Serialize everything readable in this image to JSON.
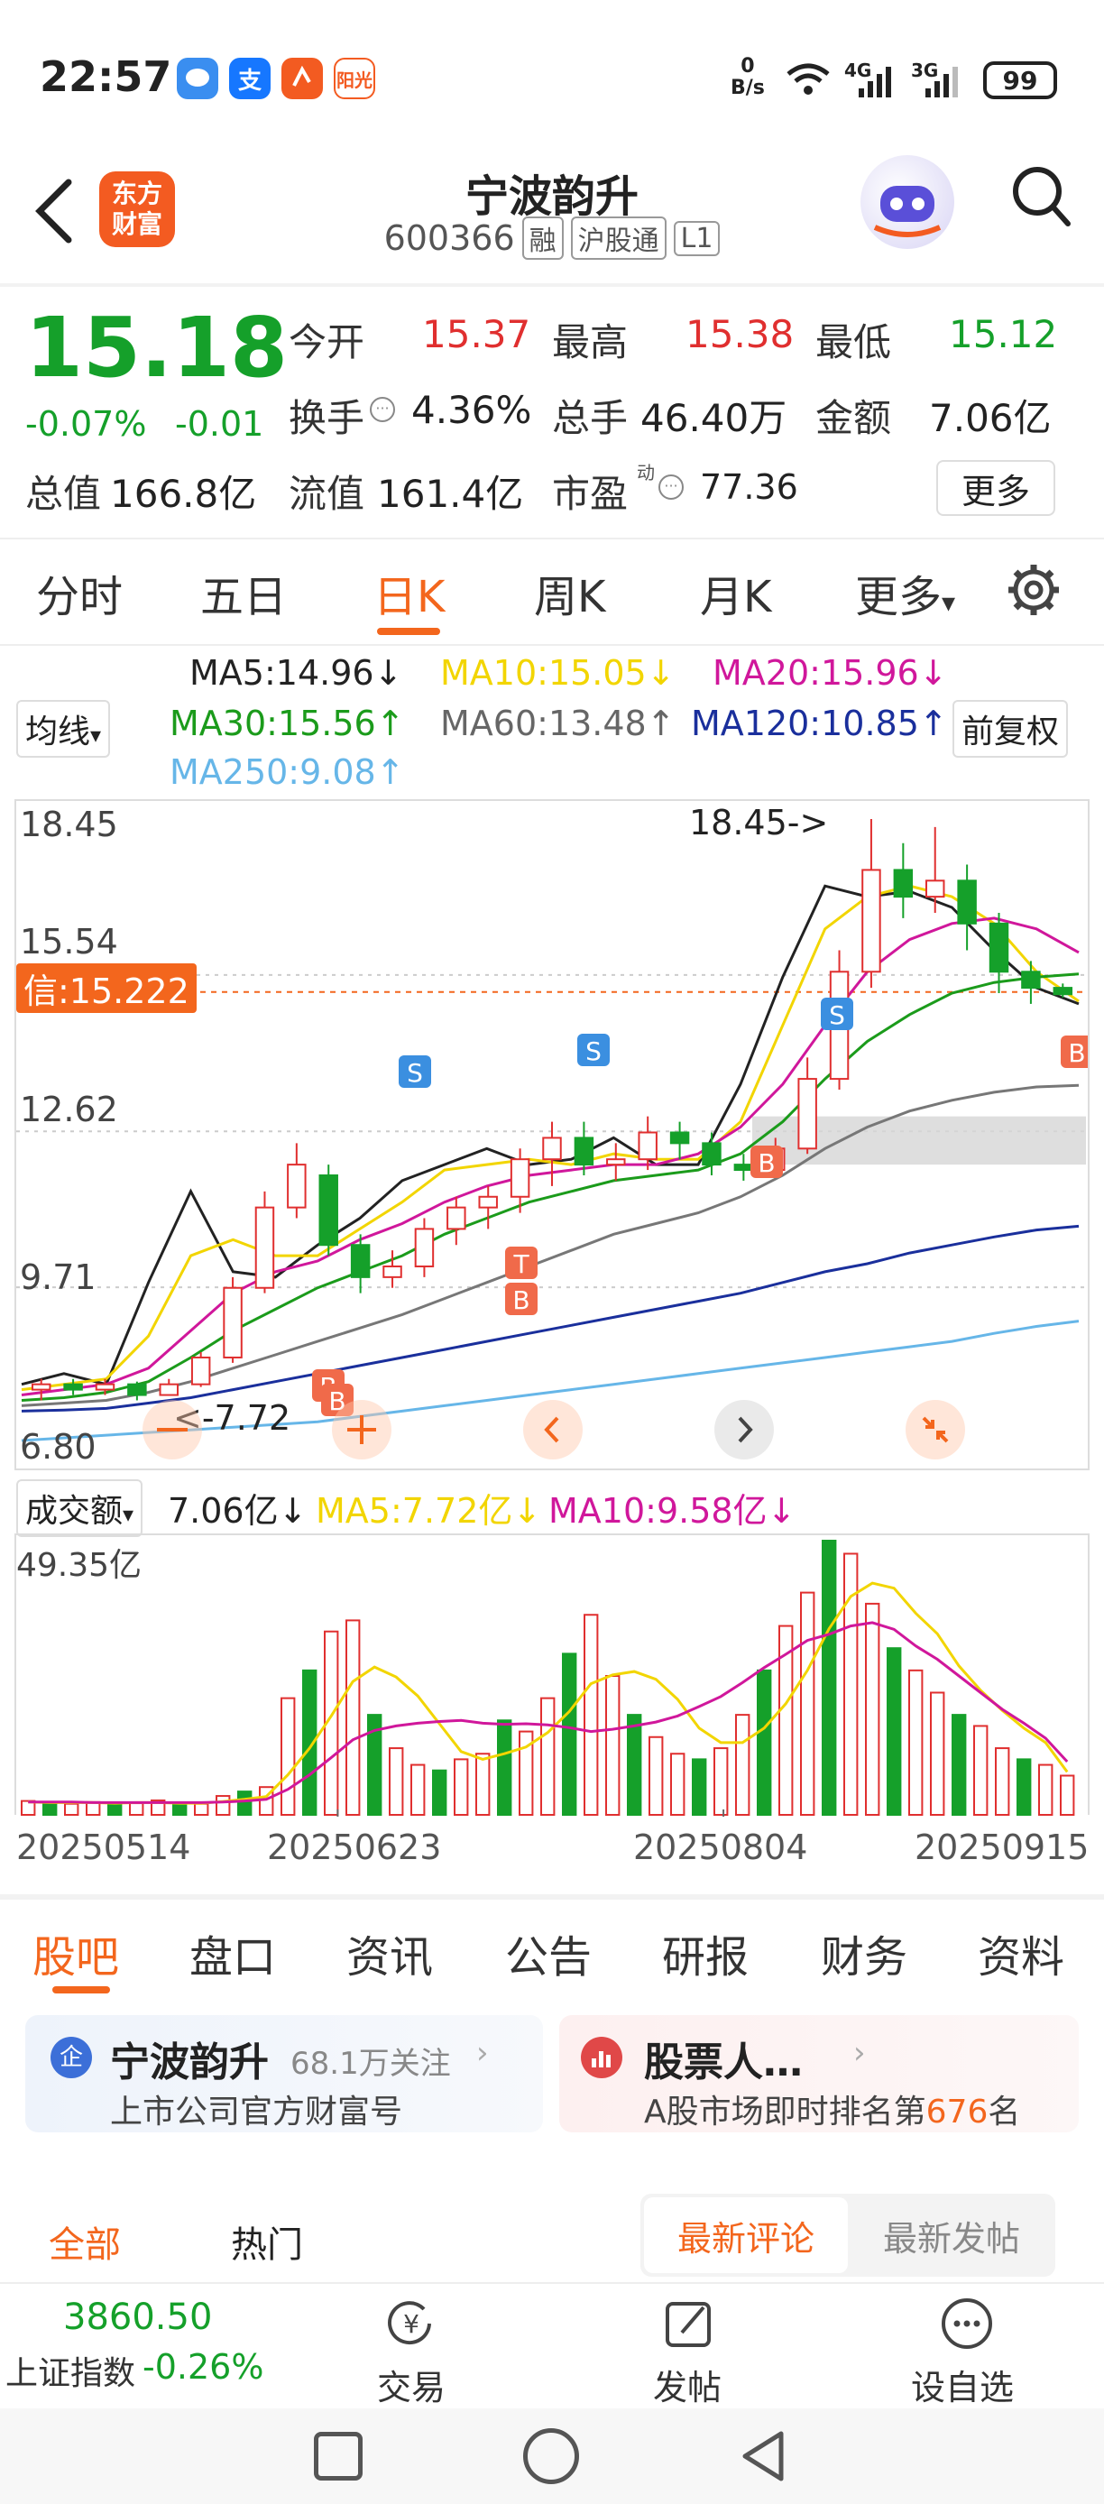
{
  "status_bar": {
    "time": "22:57",
    "net_speed": "0\nB/s",
    "signal_4g": "4G",
    "signal_3g": "3G",
    "battery": "99",
    "app_icons": [
      "message-icon",
      "alipay-icon",
      "shortcut-icon",
      "yangguang-icon"
    ],
    "alipay_glyph": "支",
    "yangguang_text": "阳光"
  },
  "header": {
    "back": "back-icon",
    "logo_text": "东方\n财富",
    "stock_name": "宁波韵升",
    "stock_code": "600366",
    "tags": [
      "融",
      "沪股通",
      "L1"
    ]
  },
  "quote": {
    "price": "15.18",
    "change_pct": "-0.07%",
    "change": "-0.01",
    "open_label": "今开",
    "open": "15.37",
    "high_label": "最高",
    "high": "15.38",
    "low_label": "最低",
    "low": "15.12",
    "turnover_label": "换手",
    "turnover": "4.36%",
    "volume_label": "总手",
    "volume": "46.40万",
    "amount_label": "金额",
    "amount": "7.06亿",
    "mcap_label": "总值",
    "mcap": "166.8亿",
    "float_label": "流值",
    "float_cap": "161.4亿",
    "pe_label": "市盈",
    "pe_sup": "动",
    "pe": "77.36",
    "more": "更多"
  },
  "kline_tabs": [
    "分时",
    "五日",
    "日K",
    "周K",
    "月K",
    "更多"
  ],
  "active_kline_tab": 2,
  "ma_legend": {
    "selector": "均线",
    "ma5": "MA5:14.96↓",
    "ma10": "MA10:15.05↓",
    "ma20": "MA20:15.96↓",
    "ma30": "MA30:15.56↑",
    "ma60": "MA60:13.48↑",
    "ma120": "MA120:10.85↑",
    "ma250": "MA250:9.08↑",
    "adjust": "前复权"
  },
  "colors": {
    "up": "#e02f2f",
    "down": "#15a02a",
    "accent": "#f3661d",
    "ma5": "#222222",
    "ma10": "#f2d500",
    "ma20": "#d0179b",
    "ma30": "#1b9b1b",
    "ma60": "#777777",
    "ma120": "#1a2f9c",
    "ma250": "#66b6e8"
  },
  "chart_data": [
    {
      "type": "candlestick",
      "y_ticks": [
        "18.45",
        "15.54",
        "12.62",
        "9.71",
        "6.80"
      ],
      "ylim": [
        6.8,
        18.45
      ],
      "cost_line_label": "信:15.222",
      "cost_line_value": 15.222,
      "high_annotation": "18.45->",
      "low_annotation": "<-7.72",
      "signals": [
        "B",
        "S",
        "T",
        "B",
        "S",
        "B",
        "S",
        "B",
        "B"
      ],
      "ma_series": [
        {
          "name": "MA5",
          "values": [
            7.9,
            8.1,
            7.9,
            9.8,
            11.5,
            10.0,
            9.9,
            10.5,
            11.0,
            11.7,
            12.0,
            12.3,
            12.0,
            12.1,
            12.5,
            12.0,
            12.0,
            13.5,
            15.5,
            17.2,
            17.0,
            17.1,
            16.8,
            16.0,
            15.3,
            15.0
          ]
        },
        {
          "name": "MA10",
          "values": [
            7.8,
            7.9,
            8.0,
            8.8,
            10.3,
            10.6,
            10.3,
            10.3,
            10.8,
            11.3,
            11.9,
            12.0,
            12.1,
            12.0,
            12.2,
            12.1,
            12.1,
            12.8,
            14.6,
            16.4,
            17.0,
            17.2,
            17.0,
            16.5,
            15.6,
            15.05
          ]
        },
        {
          "name": "MA20",
          "values": [
            7.7,
            7.8,
            7.9,
            8.2,
            8.9,
            9.6,
            10.0,
            10.2,
            10.6,
            10.9,
            11.3,
            11.6,
            11.8,
            11.9,
            12.0,
            12.0,
            12.2,
            12.7,
            13.5,
            14.6,
            15.6,
            16.2,
            16.5,
            16.6,
            16.4,
            15.96
          ]
        },
        {
          "name": "MA30",
          "values": [
            7.6,
            7.65,
            7.75,
            7.95,
            8.4,
            8.9,
            9.3,
            9.7,
            10.0,
            10.3,
            10.7,
            11.0,
            11.3,
            11.5,
            11.7,
            11.8,
            11.9,
            12.2,
            12.8,
            13.6,
            14.3,
            14.8,
            15.2,
            15.4,
            15.5,
            15.56
          ]
        },
        {
          "name": "MA60",
          "values": [
            7.5,
            7.55,
            7.6,
            7.75,
            7.95,
            8.2,
            8.45,
            8.7,
            8.95,
            9.2,
            9.5,
            9.8,
            10.1,
            10.4,
            10.7,
            10.9,
            11.1,
            11.4,
            11.8,
            12.3,
            12.7,
            13.0,
            13.2,
            13.35,
            13.45,
            13.48
          ]
        },
        {
          "name": "MA120",
          "values": [
            7.4,
            7.42,
            7.45,
            7.55,
            7.65,
            7.8,
            7.95,
            8.1,
            8.25,
            8.4,
            8.55,
            8.7,
            8.85,
            9.0,
            9.15,
            9.3,
            9.45,
            9.6,
            9.8,
            10.0,
            10.15,
            10.35,
            10.5,
            10.65,
            10.78,
            10.85
          ]
        },
        {
          "name": "MA250",
          "values": [
            6.85,
            6.9,
            6.95,
            7.0,
            7.05,
            7.1,
            7.15,
            7.2,
            7.3,
            7.4,
            7.5,
            7.6,
            7.7,
            7.8,
            7.9,
            8.0,
            8.1,
            8.2,
            8.3,
            8.4,
            8.5,
            8.6,
            8.7,
            8.85,
            8.98,
            9.08
          ]
        }
      ],
      "candles": [
        [
          7.8,
          7.9,
          7.6,
          8.0
        ],
        [
          7.9,
          7.8,
          7.7,
          8.0
        ],
        [
          7.8,
          7.9,
          7.7,
          8.0
        ],
        [
          7.9,
          7.7,
          7.6,
          7.95
        ],
        [
          7.7,
          7.9,
          7.72,
          8.0
        ],
        [
          7.9,
          8.4,
          7.85,
          8.5
        ],
        [
          8.4,
          9.7,
          8.3,
          9.9
        ],
        [
          9.7,
          11.2,
          9.6,
          11.5
        ],
        [
          11.2,
          12.0,
          11.0,
          12.4
        ],
        [
          11.8,
          10.5,
          10.3,
          12.0
        ],
        [
          10.5,
          9.9,
          9.6,
          10.7
        ],
        [
          9.9,
          10.1,
          9.7,
          10.4
        ],
        [
          10.1,
          10.8,
          9.9,
          11.0
        ],
        [
          10.8,
          11.2,
          10.5,
          11.4
        ],
        [
          11.2,
          11.4,
          10.8,
          11.6
        ],
        [
          11.4,
          12.1,
          11.1,
          12.3
        ],
        [
          12.1,
          12.5,
          11.6,
          12.8
        ],
        [
          12.5,
          12.0,
          11.8,
          12.8
        ],
        [
          12.0,
          12.1,
          11.7,
          12.4
        ],
        [
          12.1,
          12.6,
          11.9,
          12.9
        ],
        [
          12.6,
          12.4,
          12.1,
          12.8
        ],
        [
          12.4,
          12.0,
          11.8,
          12.6
        ],
        [
          12.0,
          11.9,
          11.7,
          12.2
        ],
        [
          11.9,
          12.3,
          11.8,
          12.5
        ],
        [
          12.3,
          13.6,
          12.2,
          14.0
        ],
        [
          13.6,
          15.6,
          13.4,
          16.0
        ],
        [
          15.6,
          17.5,
          15.3,
          18.45
        ],
        [
          17.5,
          17.0,
          16.6,
          18.0
        ],
        [
          17.0,
          17.3,
          16.7,
          18.3
        ],
        [
          17.3,
          16.5,
          16.0,
          17.6
        ],
        [
          16.5,
          15.6,
          15.2,
          16.7
        ],
        [
          15.6,
          15.3,
          15.0,
          15.8
        ],
        [
          15.3,
          15.18,
          15.12,
          15.38
        ]
      ]
    },
    {
      "type": "bar",
      "title": "成交额",
      "current": "7.06亿↓",
      "ma5_label": "MA5:7.72亿↓",
      "ma10_label": "MA10:9.58亿↓",
      "ymax_label": "49.35亿",
      "ylim": [
        0,
        49.35
      ],
      "x_ticks": [
        "20250514",
        "20250623",
        "20250804",
        "20250915"
      ],
      "values": [
        2.5,
        2.2,
        2.0,
        2.3,
        1.8,
        2.1,
        2.6,
        1.9,
        2.0,
        3.4,
        4.2,
        5.0,
        21.0,
        26.0,
        33.0,
        35.0,
        18.0,
        12.0,
        9.0,
        8.0,
        10.0,
        11.0,
        17.0,
        15.0,
        21.0,
        29.0,
        36.0,
        25.0,
        18.0,
        14.0,
        11.0,
        10.0,
        12.0,
        18.0,
        26.0,
        34.0,
        40.0,
        49.35,
        47.0,
        38.0,
        30.0,
        26.0,
        22.0,
        18.0,
        16.0,
        12.0,
        10.0,
        9.0,
        7.06
      ],
      "ma5": [
        2.3,
        2.2,
        2.2,
        2.2,
        2.1,
        2.2,
        2.2,
        2.1,
        2.1,
        2.4,
        2.8,
        3.3,
        7.2,
        12.0,
        17.8,
        24.0,
        26.6,
        24.8,
        21.4,
        16.4,
        11.4,
        10.0,
        11.0,
        12.2,
        14.8,
        18.6,
        23.6,
        25.2,
        25.8,
        24.4,
        20.8,
        15.6,
        13.0,
        13.0,
        15.6,
        20.0,
        26.0,
        33.5,
        39.3,
        41.7,
        40.8,
        36.3,
        32.6,
        26.8,
        22.4,
        18.8,
        15.6,
        13.0,
        7.72
      ],
      "ma10": [
        2.3,
        2.3,
        2.3,
        2.2,
        2.2,
        2.2,
        2.2,
        2.2,
        2.2,
        2.3,
        2.5,
        2.8,
        4.6,
        7.2,
        10.3,
        13.5,
        15.2,
        16.0,
        16.5,
        16.8,
        17.0,
        16.5,
        16.3,
        16.4,
        16.2,
        15.7,
        15.0,
        15.4,
        16.0,
        16.7,
        17.8,
        19.5,
        21.3,
        23.8,
        26.5,
        28.9,
        31.4,
        32.5,
        34.0,
        34.6,
        33.4,
        30.4,
        28.0,
        25.0,
        22.0,
        19.0,
        16.5,
        13.8,
        9.58
      ]
    }
  ],
  "float_buttons": [
    "zoom-out-icon",
    "zoom-in-icon",
    "prev-icon",
    "next-icon",
    "collapse-icon"
  ],
  "bottom_tabs": [
    "股吧",
    "盘口",
    "资讯",
    "公告",
    "研报",
    "财务",
    "资料"
  ],
  "active_bottom_tab": 0,
  "cards": {
    "left_badge": "企",
    "left_title": "宁波韵升",
    "left_follow": "68.1万关注",
    "left_sub": "上市公司官方财富号",
    "right_title": "股票人…",
    "right_sub_prefix": "A股市场即时排名第",
    "right_rank": "676",
    "right_sub_suffix": "名"
  },
  "feed_tabs": {
    "all": "全部",
    "hot": "热门",
    "latest_comment": "最新评论",
    "latest_post": "最新发帖"
  },
  "bottom_nav": {
    "index_value": "3860.50",
    "index_name": "上证指数",
    "index_change": "-0.26%",
    "trade": "交易",
    "post": "发帖",
    "watchlist": "设自选"
  }
}
